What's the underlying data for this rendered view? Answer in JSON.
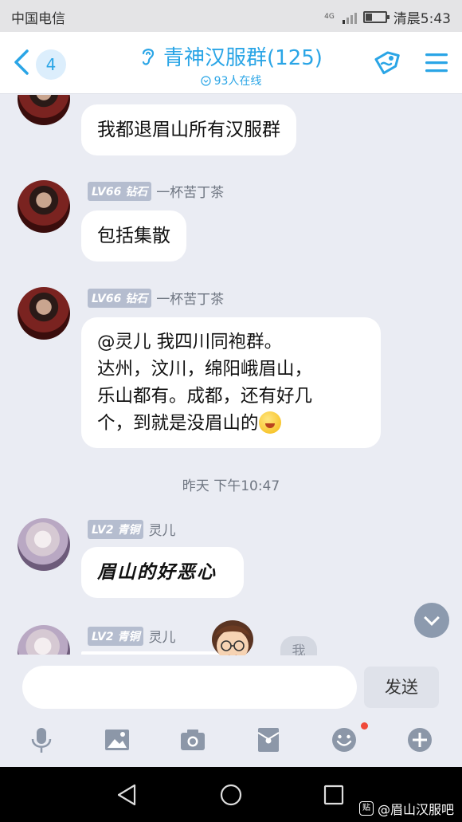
{
  "status_bar": {
    "carrier": "中国电信",
    "network": "4G",
    "battery_level": 0.35,
    "clock": "清晨5:43"
  },
  "header": {
    "unread_count": "4",
    "group_name": "青神汉服群(125)",
    "online_count": "93人在线",
    "accent_color": "#2aa5e6"
  },
  "messages": [
    {
      "type": "text",
      "text": "我都退眉山所有汉服群"
    },
    {
      "type": "text",
      "level": "LV66",
      "rank": "钻石",
      "sender": "一杯苦丁茶",
      "text": "包括集散"
    },
    {
      "type": "text",
      "level": "LV66",
      "rank": "钻石",
      "sender": "一杯苦丁茶",
      "lines": [
        "@灵儿 我四川同袍群。",
        "达州，汶川，绵阳峨眉山，",
        "乐山都有。成都，还有好几",
        "个，到就是没眉山的"
      ],
      "emoji": "grinning-emoji"
    },
    {
      "type": "timestamp",
      "text": "昨天 下午10:47"
    },
    {
      "type": "text",
      "level": "LV2",
      "rank": "青铜",
      "sender": "灵儿",
      "text": "眉山的好恶心"
    },
    {
      "type": "partial",
      "level": "LV2",
      "rank": "青铜",
      "sender": "灵儿"
    }
  ],
  "floating": {
    "me_label": "我",
    "scroll_down_icon": "chevron-down-icon"
  },
  "input_bar": {
    "placeholder": "",
    "send_label": "发送"
  },
  "toolbar_icons": [
    "microphone-icon",
    "image-icon",
    "camera-icon",
    "red-packet-icon",
    "emoji-icon",
    "plus-icon"
  ],
  "watermark": {
    "logo": "贴",
    "text": "@眉山汉服吧"
  }
}
